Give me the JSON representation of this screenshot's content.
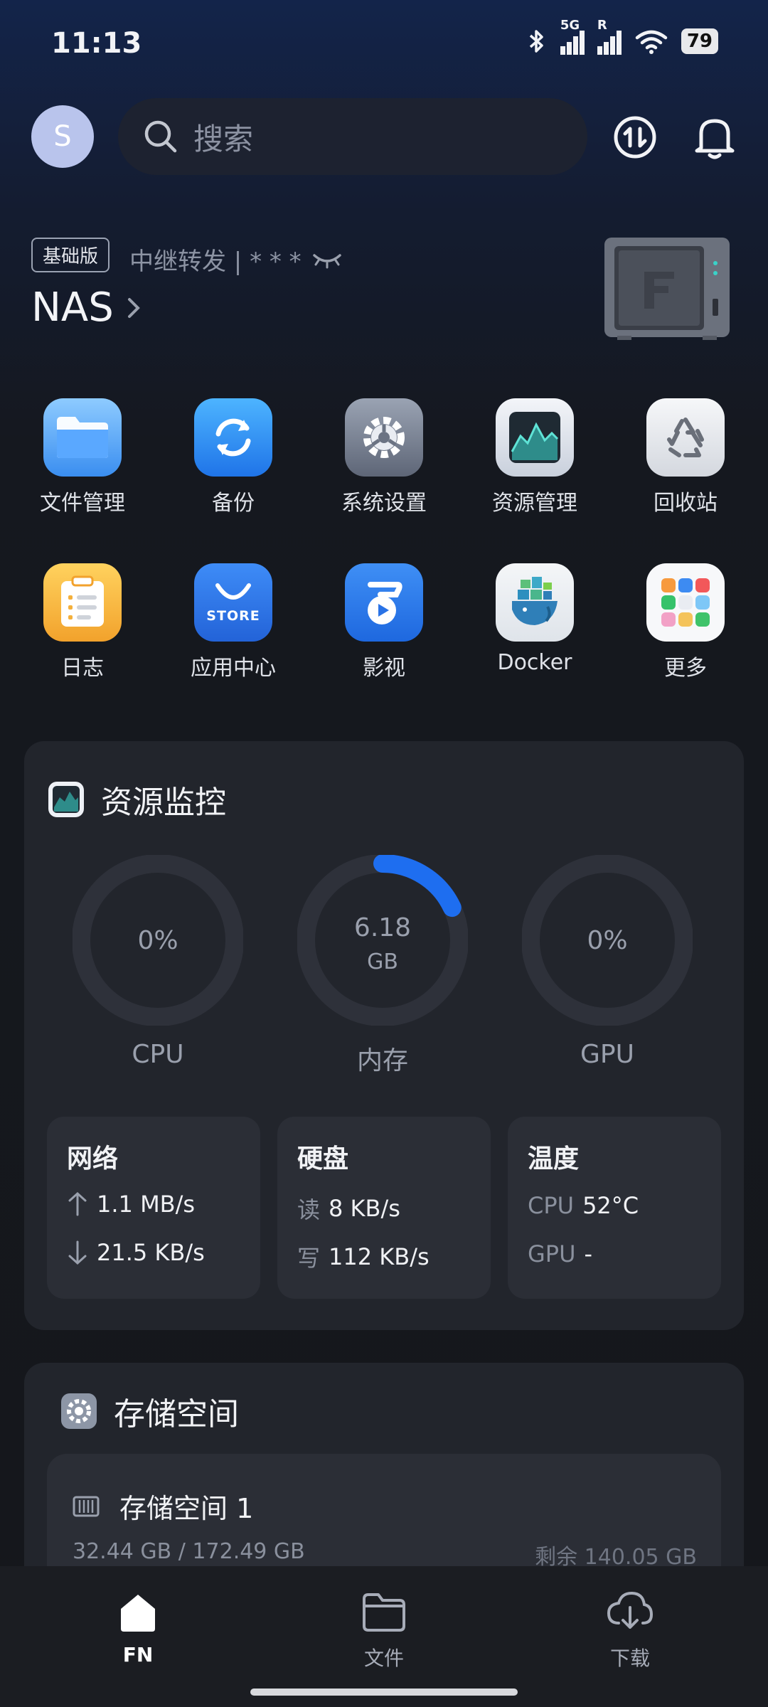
{
  "status_bar": {
    "time": "11:13",
    "network_5g": "5G",
    "roaming": "R",
    "battery": "79"
  },
  "header": {
    "avatar_letter": "S",
    "search_placeholder": "搜索"
  },
  "device": {
    "plan_badge": "基础版",
    "relay_text": "中继转发 | * * *",
    "name": "NAS"
  },
  "apps": [
    {
      "label": "文件管理",
      "icon": "folder-icon"
    },
    {
      "label": "备份",
      "icon": "backup-icon"
    },
    {
      "label": "系统设置",
      "icon": "gear-icon"
    },
    {
      "label": "资源管理",
      "icon": "monitor-chart-icon"
    },
    {
      "label": "回收站",
      "icon": "recycle-bin-icon"
    },
    {
      "label": "日志",
      "icon": "log-icon"
    },
    {
      "label": "应用中心",
      "icon": "store-icon"
    },
    {
      "label": "影视",
      "icon": "video-icon"
    },
    {
      "label": "Docker",
      "icon": "docker-icon"
    },
    {
      "label": "更多",
      "icon": "more-apps-icon"
    }
  ],
  "store_text": "STORE",
  "monitor": {
    "title": "资源监控",
    "cpu": {
      "value": "0%",
      "label": "CPU",
      "fraction": 0
    },
    "memory": {
      "value": "6.18",
      "unit": "GB",
      "label": "内存",
      "fraction": 0.18
    },
    "gpu": {
      "value": "0%",
      "label": "GPU",
      "fraction": 0
    },
    "network": {
      "title": "网络",
      "up": "1.1 MB/s",
      "down": "21.5 KB/s"
    },
    "disk": {
      "title": "硬盘",
      "read_label": "读",
      "read": "8 KB/s",
      "write_label": "写",
      "write": "112 KB/s"
    },
    "temperature": {
      "title": "温度",
      "cpu_label": "CPU",
      "cpu": "52°C",
      "gpu_label": "GPU",
      "gpu": "-"
    }
  },
  "storage": {
    "title": "存储空间",
    "volume_name": "存储空间 1",
    "used": "32.44 GB / 172.49 GB",
    "remaining": "剩余 140.05 GB"
  },
  "bottom_nav": [
    {
      "label": "FN",
      "active": true
    },
    {
      "label": "文件",
      "active": false
    },
    {
      "label": "下载",
      "active": false
    }
  ],
  "colors": {
    "accent": "#1e6ef0",
    "background": "#15171b",
    "card": "#22252c"
  }
}
